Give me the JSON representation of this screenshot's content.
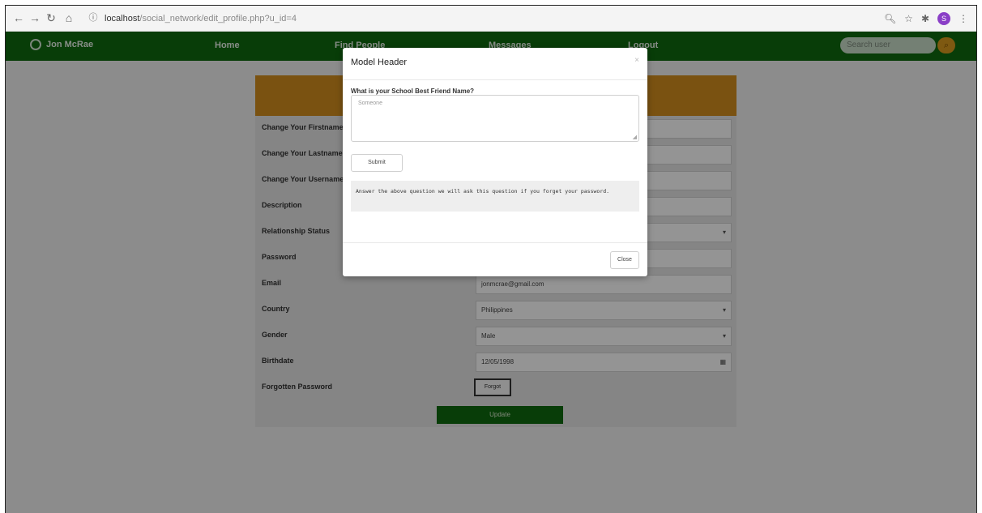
{
  "browser": {
    "url_host": "localhost",
    "url_path": "/social_network/edit_profile.php?u_id=4",
    "profile_initial": "S"
  },
  "nav": {
    "user_name": "Jon McRae",
    "links": [
      "Home",
      "Find People",
      "Messages",
      "Logout"
    ],
    "search_placeholder": "Search user",
    "search_icon": "search-icon"
  },
  "form": {
    "rows": [
      {
        "label": "Change Your Firstname",
        "value": "",
        "kind": "text"
      },
      {
        "label": "Change Your Lastname",
        "value": "",
        "kind": "text"
      },
      {
        "label": "Change Your Username",
        "value": "",
        "kind": "text"
      },
      {
        "label": "Description",
        "value": "",
        "kind": "text"
      },
      {
        "label": "Relationship Status",
        "value": "",
        "kind": "select"
      },
      {
        "label": "Password",
        "value": "",
        "kind": "text"
      },
      {
        "label": "Email",
        "value": "jonmcrae@gmail.com",
        "kind": "text"
      },
      {
        "label": "Country",
        "value": "Philippines",
        "kind": "select"
      },
      {
        "label": "Gender",
        "value": "Male",
        "kind": "select"
      },
      {
        "label": "Birthdate",
        "value": "12/05/1998",
        "kind": "date"
      },
      {
        "label": "Forgotten Password",
        "value": "Forgot",
        "kind": "button"
      }
    ],
    "update_label": "Update"
  },
  "modal": {
    "title": "Model Header",
    "close_x": "×",
    "question": "What is your School Best Friend Name?",
    "answer_placeholder": "Someone",
    "submit_label": "Submit",
    "note": "Answer the above question we will ask this question if you forget your password.",
    "close_label": "Close"
  },
  "colors": {
    "nav_green": "#0e6a0e",
    "header_orange": "#d38d1e"
  }
}
